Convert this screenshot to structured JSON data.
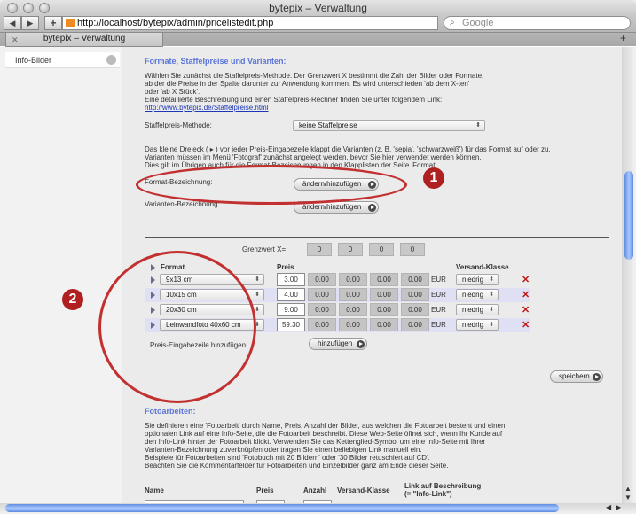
{
  "window": {
    "title": "bytepix – Verwaltung"
  },
  "toolbar": {
    "back": "◀",
    "forward": "▶",
    "add": "+",
    "url": "http://localhost/bytepix/admin/pricelistedit.php",
    "search_placeholder": "Google"
  },
  "tab": {
    "label": "bytepix – Verwaltung"
  },
  "sidebar": {
    "items": [
      {
        "label": "Info-Bilder"
      }
    ]
  },
  "section1": {
    "heading": "Formate, Staffelpreise und Varianten:",
    "desc": [
      "Wählen Sie zunächst die Staffelpreis-Methode. Der Grenzwert X bestimmt die Zahl der Bilder oder Formate,",
      "ab der die Preise in der Spalte darunter zur Anwendung kommen. Es wird unterschieden 'ab dem X-ten'",
      "oder 'ab X Stück'.",
      "Eine detaillierte Beschreibung und einen Staffelpreis-Rechner finden Sie unter folgendem Link:"
    ],
    "link": "http://www.bytepix.de/Staffelpreise.html",
    "method_label": "Staffelpreis-Methode:",
    "method_value": "keine Staffelpreise",
    "info": [
      "Das kleine Dreieck ( ▸ ) vor jeder Preis-Eingabezeile klappt die Varianten (z. B. 'sepia', 'schwarzweiß') für das Format auf oder zu.",
      "Varianten müssen im Menü 'Fotograf' zunächst angelegt werden, bevor Sie hier verwendet werden können.",
      "Dies gilt im Übrigen auch für die Format-Bezeichnungen in den Klapplisten der Seite 'Format'."
    ],
    "format_label": "Format-Bezeichnung:",
    "format_button": "ändern/hinzufügen",
    "variant_label": "Varianten-Bezeichnung:",
    "variant_button": "ändern/hinzufügen"
  },
  "table": {
    "grenzwert_label": "Grenzwert X=",
    "grenzwert": [
      "0",
      "0",
      "0",
      "0"
    ],
    "col_format": "Format",
    "col_preis": "Preis",
    "col_versand": "Versand-Klasse",
    "rows": [
      {
        "format": "9x13 cm",
        "price": "3.00",
        "tiers": [
          "0.00",
          "0.00",
          "0.00",
          "0.00"
        ],
        "currency": "EUR",
        "shipping": "niedrig"
      },
      {
        "format": "10x15 cm",
        "price": "4.00",
        "tiers": [
          "0.00",
          "0.00",
          "0.00",
          "0.00"
        ],
        "currency": "EUR",
        "shipping": "niedrig"
      },
      {
        "format": "20x30 cm",
        "price": "9.00",
        "tiers": [
          "0.00",
          "0.00",
          "0.00",
          "0.00"
        ],
        "currency": "EUR",
        "shipping": "niedrig"
      },
      {
        "format": "Leinwandfoto 40x60 cm",
        "price": "59.30",
        "tiers": [
          "0.00",
          "0.00",
          "0.00",
          "0.00"
        ],
        "currency": "EUR",
        "shipping": "niedrig"
      }
    ],
    "add_row_label": "Preis-Eingabezeile hinzufügen:",
    "add_row_button": "hinzufügen"
  },
  "save_button": "speichern",
  "section2": {
    "heading": "Fotoarbeiten:",
    "desc": [
      "Sie definieren eine 'Fotoarbeit' durch Name, Preis, Anzahl der Bilder, aus welchen die Fotoarbeit besteht und einen",
      "optionalen Link auf eine Info-Seite, die die Fotoarbeit beschreibt. Diese Web-Seite öffnet sich, wenn Ihr Kunde auf",
      "den Info-Link hinter der Fotoarbeit klickt. Verwenden Sie das Kettenglied-Symbol um eine Info-Seite mit Ihrer",
      "Varianten-Bezeichnung zuverknüpfen oder tragen Sie einen beliebigen Link manuell ein.",
      "Beispiele für Fotoarbeiten sind 'Fotobuch mit 20 Bildern' oder '30 Bilder retuschiert auf CD'.",
      "Beachten Sie die Kommentarfelder für Fotoarbeiten und Einzelbilder ganz am Ende dieser Seite."
    ],
    "cols": {
      "name": "Name",
      "preis": "Preis",
      "anzahl": "Anzahl",
      "versand": "Versand-Klasse",
      "link": "Link auf Beschreibung",
      "link_sub": "(= \"Info-Link\")"
    }
  },
  "annotations": {
    "marker1": "1",
    "marker2": "2"
  },
  "colors": {
    "accent": "#5a74d8",
    "annotation": "#c23030",
    "delete": "#c21818"
  }
}
